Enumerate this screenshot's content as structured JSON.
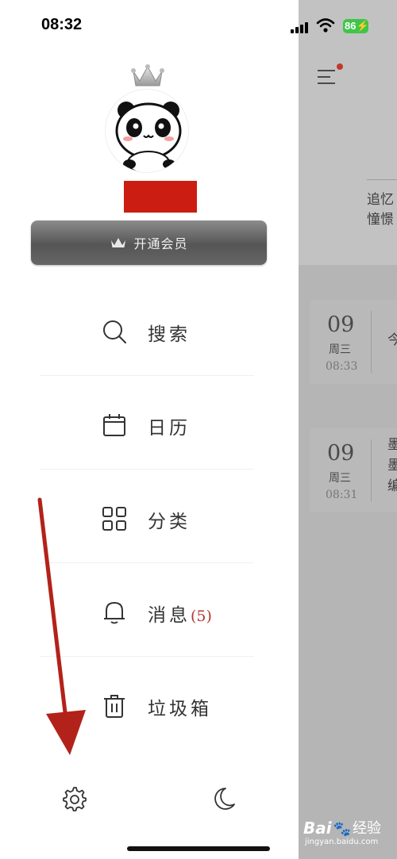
{
  "status_bar": {
    "time": "08:32",
    "battery": "86"
  },
  "drawer": {
    "vip_button": {
      "label": "开通会员"
    },
    "nav": [
      {
        "id": "search",
        "label": "搜索",
        "icon": "search-icon"
      },
      {
        "id": "calendar",
        "label": "日历",
        "icon": "calendar-icon"
      },
      {
        "id": "category",
        "label": "分类",
        "icon": "grid-icon"
      },
      {
        "id": "messages",
        "label": "消息",
        "count": "(5)",
        "icon": "bell-icon"
      },
      {
        "id": "trash",
        "label": "垃圾箱",
        "icon": "trash-icon"
      }
    ],
    "footer": {
      "settings_icon": "gear-icon",
      "dark_mode_icon": "moon-icon"
    }
  },
  "main": {
    "quote": "追忆\n憧憬",
    "entries": [
      {
        "day": "09",
        "weekday": "周三",
        "time": "08:33",
        "preview": "今"
      },
      {
        "day": "09",
        "weekday": "周三",
        "time": "08:31",
        "preview": "墨\n墨\n编"
      }
    ]
  },
  "watermark": {
    "brand": "Bai",
    "suffix": "经验",
    "url": "jingyan.baidu.com"
  },
  "colors": {
    "accent_red": "#cc1d12",
    "vip_gray": "#5c5c5c",
    "battery_green": "#3ec54a",
    "arrow_red": "#b3221a"
  }
}
